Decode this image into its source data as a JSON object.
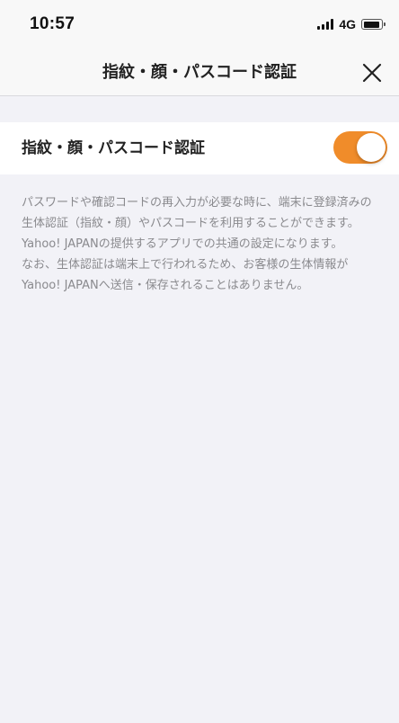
{
  "status_bar": {
    "time": "10:57",
    "network": "4G",
    "battery_level": 0.9
  },
  "nav": {
    "title": "指紋・顔・パスコード認証",
    "close_icon": "close-icon"
  },
  "setting": {
    "label": "指紋・顔・パスコード認証",
    "toggle_on": true,
    "toggle_color": "#f08c2a"
  },
  "description": {
    "line1": "パスワードや確認コードの再入力が必要な時に、端末に登録済みの生体認証（指紋・顔）やパスコードを利用することができます。Yahoo! JAPANの提供するアプリでの共通の設定になります。",
    "line2": "なお、生体認証は端末上で行われるため、お客様の生体情報がYahoo! JAPANへ送信・保存されることはありません。"
  }
}
